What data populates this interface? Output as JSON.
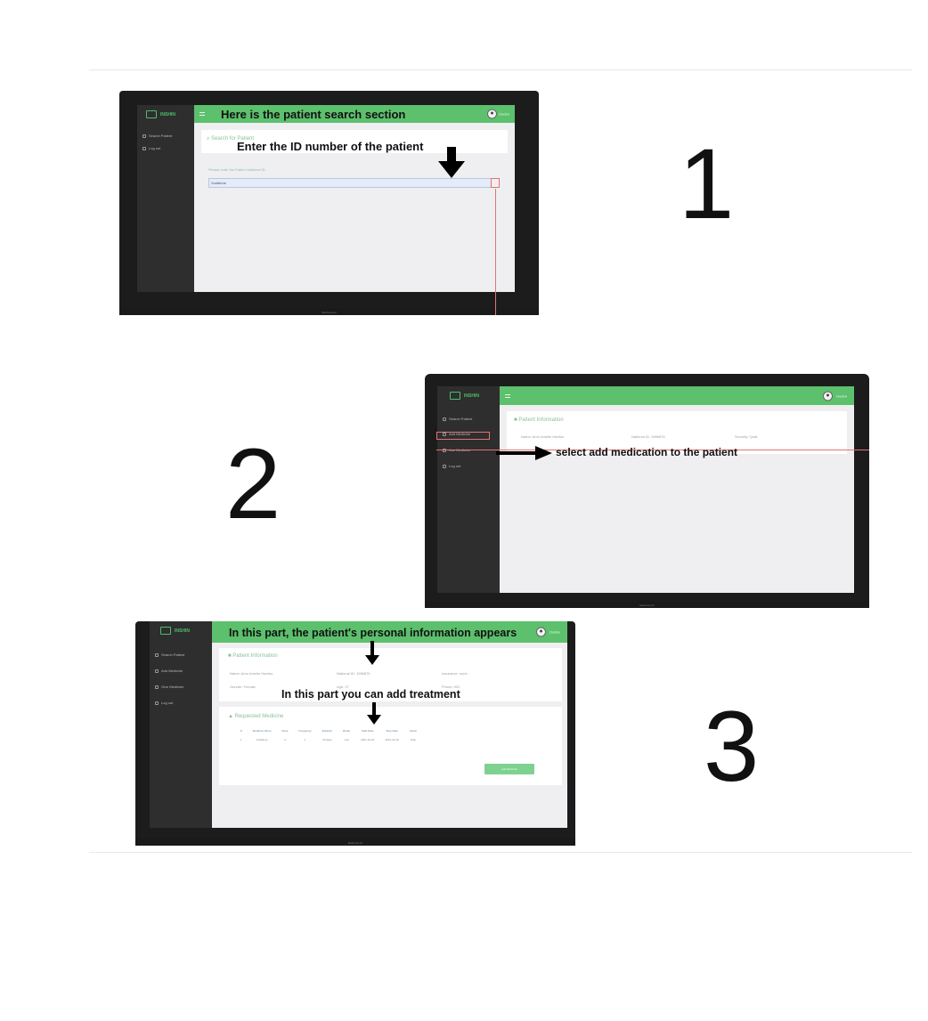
{
  "steps": [
    {
      "number": "1",
      "callouts": [
        "Here is the patient search section",
        "Enter the ID number of the patient"
      ],
      "app": {
        "logo": "INSHIN",
        "nav": [
          "Search Patient",
          "Log out"
        ],
        "search_title": "Search for Patient",
        "field_label": "Please enter the Patient National ID",
        "field_value": "Vodafone",
        "user": "Doctor",
        "chin_label": "Macbook Air"
      }
    },
    {
      "number": "2",
      "callouts": [
        "select add medication to the patient"
      ],
      "app": {
        "logo": "INSHIN",
        "nav": [
          "Search Patient",
          "Add Medicine",
          "Use Medicine",
          "Log out"
        ],
        "section_title": "Patient Information",
        "info": [
          "Name: Arno Amelie Hantoo",
          "National ID: 1986876",
          "Security: Quat"
        ],
        "user": "Doctor",
        "chin_label": "Macbook Air"
      }
    },
    {
      "number": "3",
      "callouts": [
        "In this part, the patient's personal information appears",
        "In this part you can add treatment"
      ],
      "app": {
        "logo": "INSHIN",
        "nav": [
          "Search Patient",
          "Add Medicine",
          "Give Medicine",
          "Log out"
        ],
        "section_title": "Patient Information",
        "info": [
          "Name: Arno Amelie Hantoo",
          "National ID: 1986876",
          "Insurance: none",
          "Gender: Female",
          "Age: 27",
          "Phone: 051"
        ],
        "medicine_title": "Requested Medicine",
        "table": {
          "headers": [
            "#",
            "Medicine Name",
            "Dose",
            "Frequency",
            "Duration",
            "Route",
            "Start Date",
            "Stop Date",
            "Action"
          ],
          "rows": [
            [
              "1",
              "Vodafone",
              "4",
              "1",
              "15 days",
              "oral",
              "2021-12-01",
              "2021-12-16",
              "Stop"
            ]
          ]
        },
        "button": "Add Medicine",
        "user": "Doctor",
        "chin_label": "Macbook Air"
      }
    }
  ]
}
